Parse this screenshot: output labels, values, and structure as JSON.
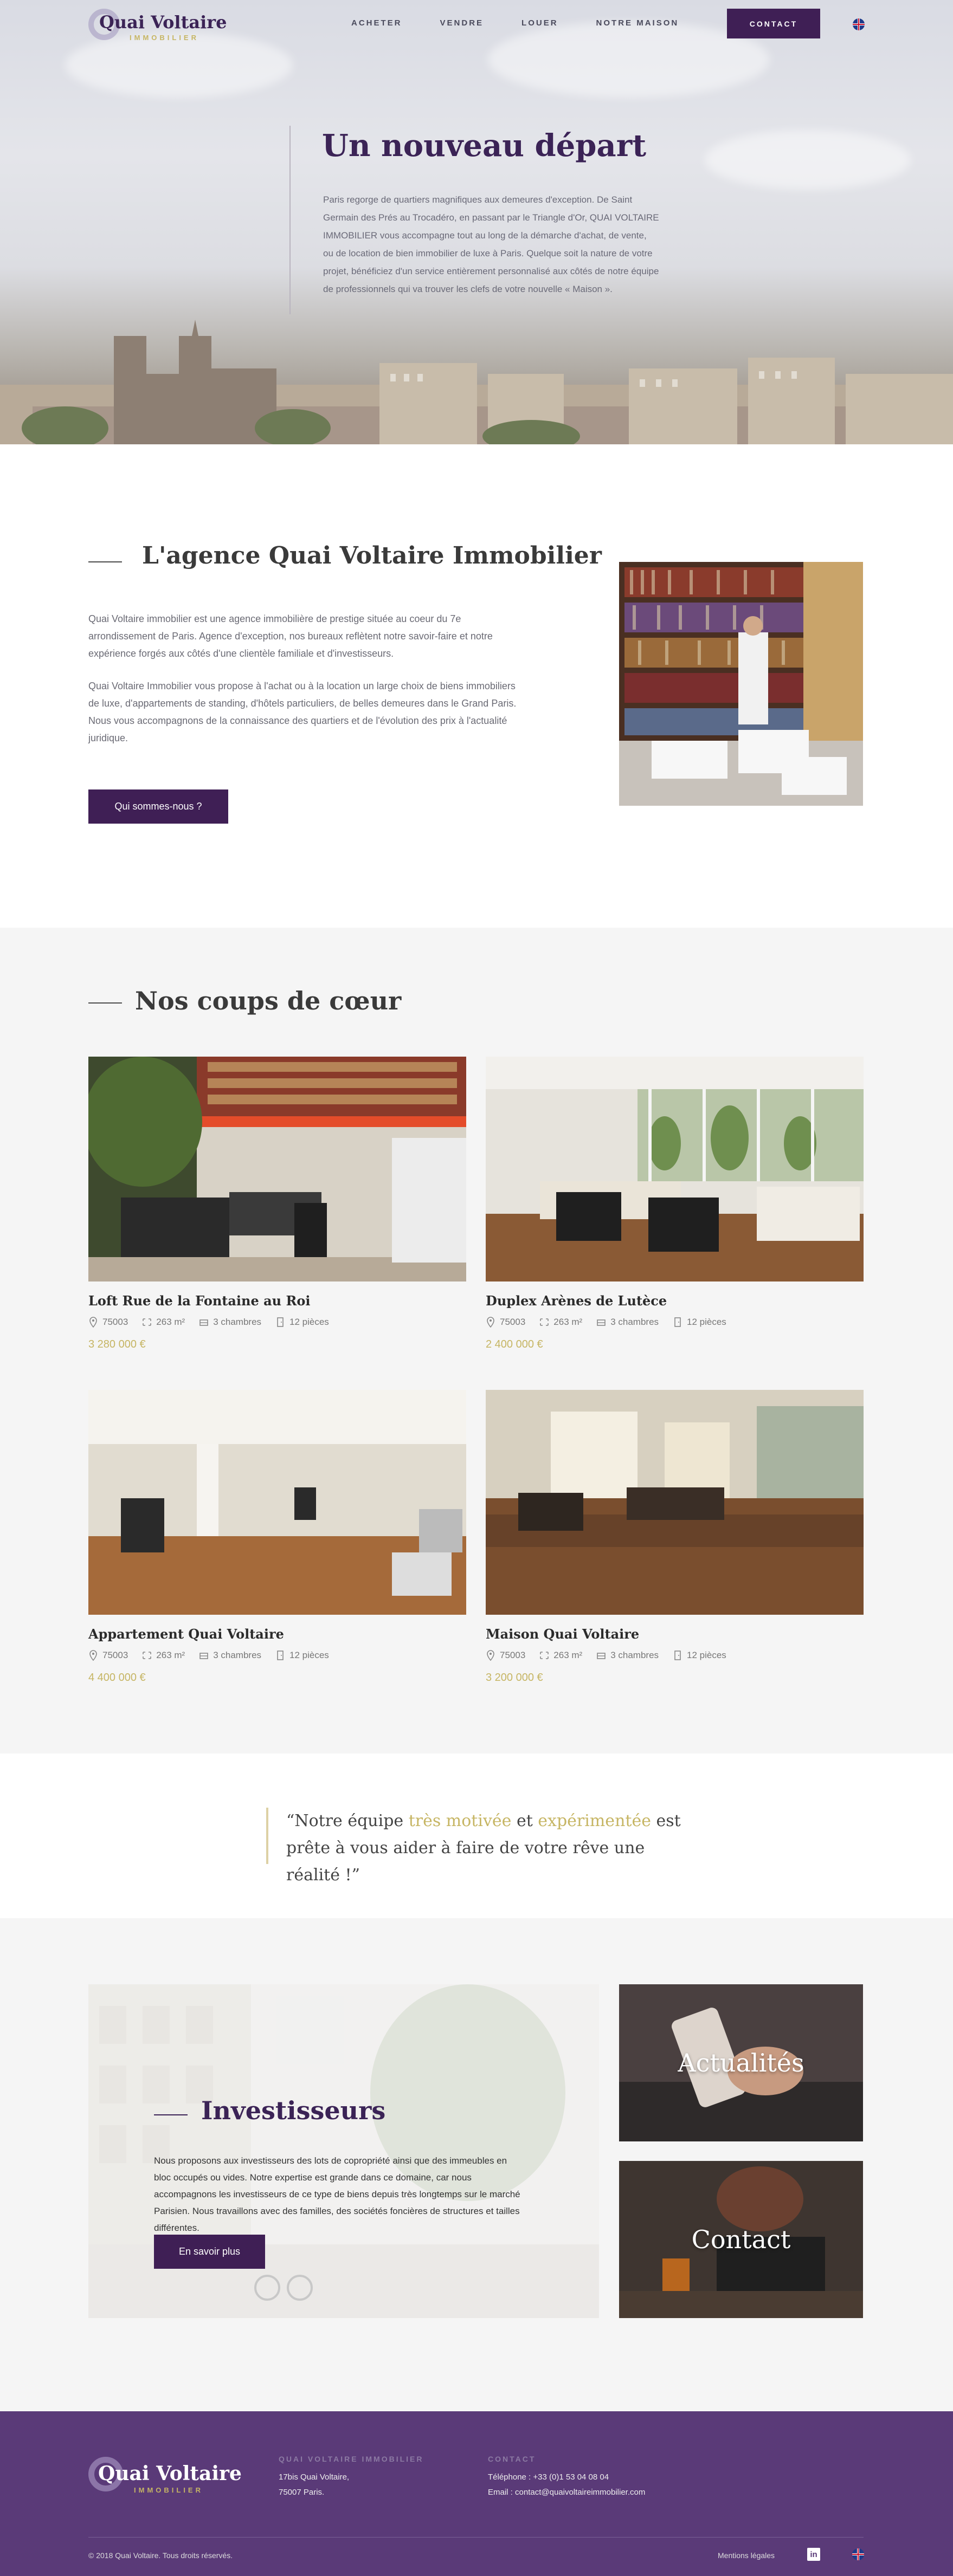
{
  "brand": {
    "name": "Quai Voltaire",
    "tagline": "IMMOBILIER"
  },
  "nav": {
    "items": [
      "ACHETER",
      "VENDRE",
      "LOUER",
      "NOTRE MAISON"
    ],
    "contact_label": "CONTACT",
    "language_icon": "uk-flag-icon"
  },
  "hero": {
    "title": "Un nouveau départ",
    "text": "Paris regorge de quartiers magnifiques aux demeures d'exception. De Saint Germain des Prés au Trocadéro, en passant par le Triangle d'Or, QUAI VOLTAIRE IMMOBILIER vous accompagne tout au long de la démarche d'achat, de vente, ou de location de bien immobilier de luxe à Paris. Quelque soit la nature de votre projet, bénéficiez d'un service entièrement personnalisé aux côtés de notre équipe de professionnels qui va trouver les clefs de votre nouvelle « Maison »."
  },
  "agency": {
    "title": "L'agence Quai Voltaire Immobilier",
    "p1": "Quai Voltaire immobilier est une agence immobilière de prestige située au coeur du 7e arrondissement de Paris. Agence d'exception, nos bureaux reflètent notre savoir-faire et notre expérience forgés aux côtés d'une clientèle familiale et d'investisseurs.",
    "p2": "Quai Voltaire Immobilier vous propose à l'achat ou à la location un large choix de biens immobiliers de luxe, d'appartements de standing, d'hôtels particuliers, de belles demeures dans le Grand Paris. Nous vous accompagnons de la connaissance des quartiers et de l'évolution des prix à l'actualité juridique.",
    "button": "Qui sommes-nous ?"
  },
  "coups": {
    "title": "Nos coups de cœur",
    "cards": [
      {
        "title": "Loft Rue de la Fontaine au Roi",
        "postcode": "75003",
        "area": "263 m²",
        "bedrooms": "3 chambres",
        "rooms": "12 pièces",
        "price": "3 280 000 €"
      },
      {
        "title": "Duplex Arènes de Lutèce",
        "postcode": "75003",
        "area": "263 m²",
        "bedrooms": "3 chambres",
        "rooms": "12 pièces",
        "price": "2 400 000 €"
      },
      {
        "title": "Appartement Quai Voltaire",
        "postcode": "75003",
        "area": "263 m²",
        "bedrooms": "3 chambres",
        "rooms": "12 pièces",
        "price": "4 400 000 €"
      },
      {
        "title": "Maison Quai Voltaire",
        "postcode": "75003",
        "area": "263 m²",
        "bedrooms": "3 chambres",
        "rooms": "12 pièces",
        "price": "3 200 000 €"
      }
    ]
  },
  "quote": {
    "part1": "“Notre équipe ",
    "highlight1": "très motivée",
    "part2": " et ",
    "highlight2": "expérimentée",
    "part3": " est prête à vous aider à faire de votre rêve une réalité !”"
  },
  "investors": {
    "title": "Investisseurs",
    "text": "Nous proposons aux investisseurs des lots de copropriété ainsi que des immeubles en bloc occupés ou vides. Notre expertise est grande dans ce domaine, car nous accompagnons les investisseurs de ce type de biens depuis très longtemps sur le marché Parisien. Nous travaillons avec des familles, des sociétés foncières de structures et tailles différentes.",
    "button": "En savoir plus",
    "news_label": "Actualités",
    "contact_label": "Contact"
  },
  "footer": {
    "col1_head": "QUAI VOLTAIRE IMMOBILIER",
    "address1": "17bis Quai Voltaire,",
    "address2": "75007 Paris.",
    "col2_head": "CONTACT",
    "phone": "Téléphone : +33 (0)1 53 04 08 04",
    "email": "Email : contact@quaivoltaireimmobilier.com",
    "copyright": "© 2018 Quai Voltaire. Tous droits réservés.",
    "legal": "Mentions légales",
    "linkedin_icon": "linkedin-icon"
  },
  "colors": {
    "primary": "#3f1f55",
    "gold": "#c6b563",
    "footer": "#5a3a78",
    "section_bg": "#f5f5f5"
  }
}
